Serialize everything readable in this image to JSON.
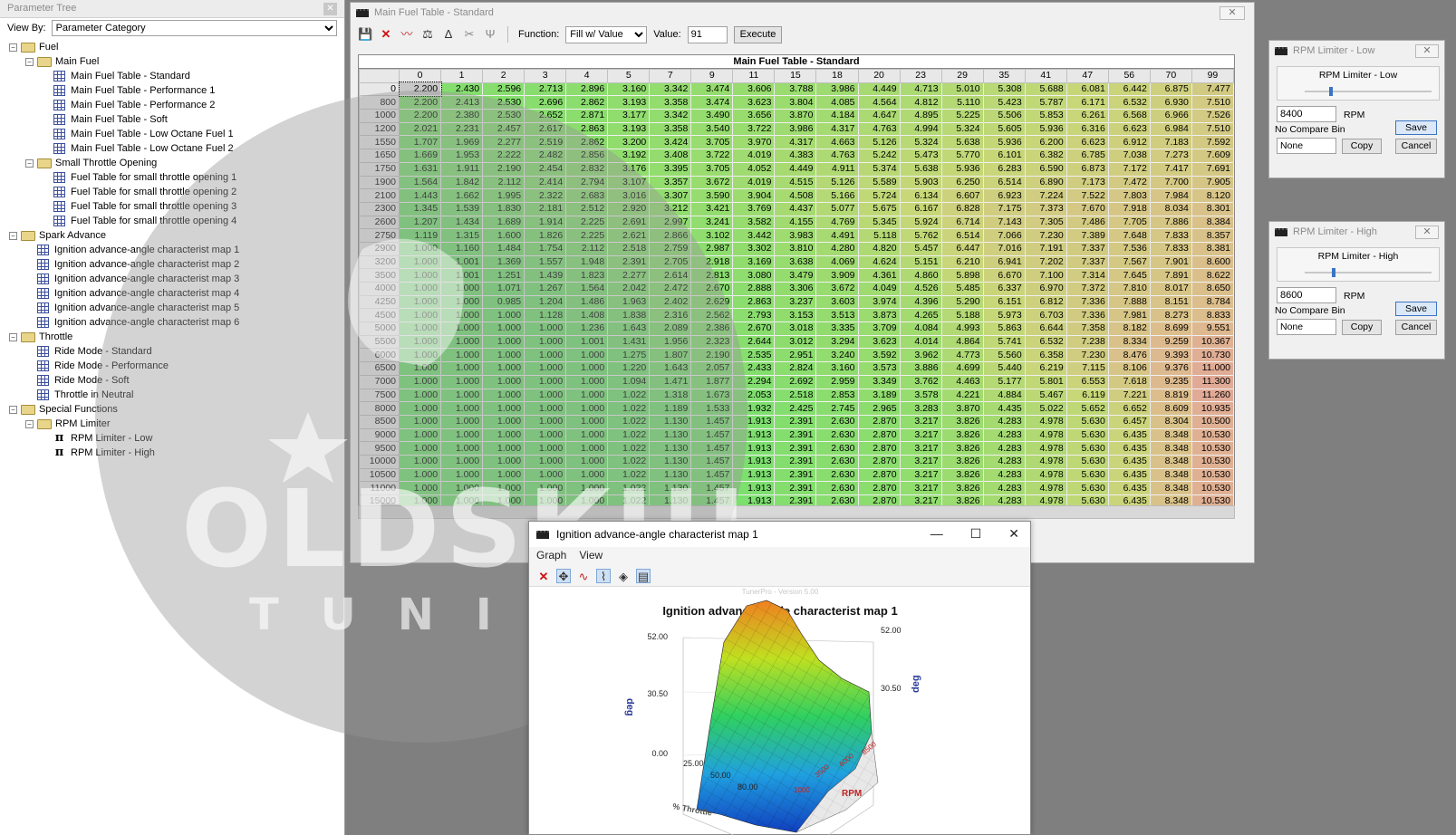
{
  "tree_panel": {
    "title": "Parameter Tree",
    "view_by_label": "View By:",
    "view_by_value": "Parameter Category",
    "nodes": [
      {
        "level": 0,
        "type": "folder",
        "label": "Fuel"
      },
      {
        "level": 1,
        "type": "folder",
        "label": "Main Fuel"
      },
      {
        "level": 2,
        "type": "table",
        "label": "Main Fuel Table - Standard"
      },
      {
        "level": 2,
        "type": "table",
        "label": "Main Fuel Table - Performance 1"
      },
      {
        "level": 2,
        "type": "table",
        "label": "Main Fuel Table - Performance 2"
      },
      {
        "level": 2,
        "type": "table",
        "label": "Main Fuel Table - Soft"
      },
      {
        "level": 2,
        "type": "table",
        "label": "Main Fuel Table - Low Octane Fuel 1"
      },
      {
        "level": 2,
        "type": "table",
        "label": "Main Fuel Table - Low Octane Fuel 2"
      },
      {
        "level": 1,
        "type": "folder",
        "label": "Small Throttle Opening"
      },
      {
        "level": 2,
        "type": "table",
        "label": "Fuel Table for small throttle opening 1"
      },
      {
        "level": 2,
        "type": "table",
        "label": "Fuel Table for small throttle opening 2"
      },
      {
        "level": 2,
        "type": "table",
        "label": "Fuel Table for small throttle opening 3"
      },
      {
        "level": 2,
        "type": "table",
        "label": "Fuel Table for small throttle opening 4"
      },
      {
        "level": 0,
        "type": "folder",
        "label": "Spark Advance"
      },
      {
        "level": 1,
        "type": "table",
        "label": "Ignition advance-angle characterist map 1"
      },
      {
        "level": 1,
        "type": "table",
        "label": "Ignition advance-angle characterist map 2"
      },
      {
        "level": 1,
        "type": "table",
        "label": "Ignition advance-angle characterist map 3"
      },
      {
        "level": 1,
        "type": "table",
        "label": "Ignition advance-angle characterist map 4"
      },
      {
        "level": 1,
        "type": "table",
        "label": "Ignition advance-angle characterist map 5"
      },
      {
        "level": 1,
        "type": "table",
        "label": "Ignition advance-angle characterist map 6"
      },
      {
        "level": 0,
        "type": "folder",
        "label": "Throttle"
      },
      {
        "level": 1,
        "type": "table",
        "label": "Ride Mode - Standard"
      },
      {
        "level": 1,
        "type": "table",
        "label": "Ride Mode - Performance"
      },
      {
        "level": 1,
        "type": "table",
        "label": "Ride Mode - Soft"
      },
      {
        "level": 1,
        "type": "table",
        "label": "Throttle in Neutral"
      },
      {
        "level": 0,
        "type": "folder",
        "label": "Special Functions"
      },
      {
        "level": 1,
        "type": "folder",
        "label": "RPM Limiter"
      },
      {
        "level": 2,
        "type": "scalar",
        "label": "RPM Limiter - Low"
      },
      {
        "level": 2,
        "type": "scalar",
        "label": "RPM Limiter - High"
      }
    ]
  },
  "main_window": {
    "title": "Main Fuel Table - Standard",
    "function_label": "Function:",
    "function_value": "Fill w/ Value",
    "value_label": "Value:",
    "value_value": "91",
    "execute_label": "Execute",
    "table_title": "Main Fuel Table - Standard",
    "col_headers": [
      "0",
      "1",
      "2",
      "3",
      "4",
      "5",
      "7",
      "9",
      "11",
      "15",
      "18",
      "20",
      "23",
      "29",
      "35",
      "41",
      "47",
      "56",
      "70",
      "99"
    ],
    "row_headers": [
      "0",
      "800",
      "1000",
      "1200",
      "1550",
      "1650",
      "1750",
      "1900",
      "2100",
      "2300",
      "2600",
      "2750",
      "2900",
      "3200",
      "3500",
      "4000",
      "4250",
      "4500",
      "5000",
      "5500",
      "6000",
      "6500",
      "7000",
      "7500",
      "8000",
      "8500",
      "9000",
      "9500",
      "10000",
      "10500",
      "11000",
      "15000"
    ],
    "rows": [
      [
        "2.200",
        "2.430",
        "2.596",
        "2.713",
        "2.896",
        "3.160",
        "3.342",
        "3.474",
        "3.606",
        "3.788",
        "3.986",
        "4.449",
        "4.713",
        "5.010",
        "5.308",
        "5.688",
        "6.081",
        "6.442",
        "6.875",
        "7.477"
      ],
      [
        "2.200",
        "2.413",
        "2.530",
        "2.696",
        "2.862",
        "3.193",
        "3.358",
        "3.474",
        "3.623",
        "3.804",
        "4.085",
        "4.564",
        "4.812",
        "5.110",
        "5.423",
        "5.787",
        "6.171",
        "6.532",
        "6.930",
        "7.510"
      ],
      [
        "2.200",
        "2.380",
        "2.530",
        "2.652",
        "2.871",
        "3.177",
        "3.342",
        "3.490",
        "3.656",
        "3.870",
        "4.184",
        "4.647",
        "4.895",
        "5.225",
        "5.506",
        "5.853",
        "6.261",
        "6.568",
        "6.966",
        "7.526"
      ],
      [
        "2.021",
        "2.231",
        "2.457",
        "2.617",
        "2.863",
        "3.193",
        "3.358",
        "3.540",
        "3.722",
        "3.986",
        "4.317",
        "4.763",
        "4.994",
        "5.324",
        "5.605",
        "5.936",
        "6.316",
        "6.623",
        "6.984",
        "7.510"
      ],
      [
        "1.707",
        "1.969",
        "2.277",
        "2.519",
        "2.862",
        "3.200",
        "3.424",
        "3.705",
        "3.970",
        "4.317",
        "4.663",
        "5.126",
        "5.324",
        "5.638",
        "5.936",
        "6.200",
        "6.623",
        "6.912",
        "7.183",
        "7.592"
      ],
      [
        "1.669",
        "1.953",
        "2.222",
        "2.482",
        "2.856",
        "3.192",
        "3.408",
        "3.722",
        "4.019",
        "4.383",
        "4.763",
        "5.242",
        "5.473",
        "5.770",
        "6.101",
        "6.382",
        "6.785",
        "7.038",
        "7.273",
        "7.609"
      ],
      [
        "1.631",
        "1.911",
        "2.190",
        "2.454",
        "2.832",
        "3.176",
        "3.395",
        "3.705",
        "4.052",
        "4.449",
        "4.911",
        "5.374",
        "5.638",
        "5.936",
        "6.283",
        "6.590",
        "6.873",
        "7.172",
        "7.417",
        "7.691"
      ],
      [
        "1.564",
        "1.842",
        "2.112",
        "2.414",
        "2.794",
        "3.107",
        "3.357",
        "3.672",
        "4.019",
        "4.515",
        "5.126",
        "5.589",
        "5.903",
        "6.250",
        "6.514",
        "6.890",
        "7.173",
        "7.472",
        "7.700",
        "7.905"
      ],
      [
        "1.443",
        "1.662",
        "1.995",
        "2.322",
        "2.683",
        "3.016",
        "3.307",
        "3.590",
        "3.904",
        "4.508",
        "5.166",
        "5.724",
        "6.134",
        "6.607",
        "6.923",
        "7.224",
        "7.522",
        "7.803",
        "7.984",
        "8.120"
      ],
      [
        "1.345",
        "1.539",
        "1.830",
        "2.181",
        "2.512",
        "2.920",
        "3.212",
        "3.421",
        "3.769",
        "4.437",
        "5.077",
        "5.675",
        "6.167",
        "6.828",
        "7.175",
        "7.373",
        "7.670",
        "7.918",
        "8.034",
        "8.301"
      ],
      [
        "1.207",
        "1.434",
        "1.689",
        "1.914",
        "2.225",
        "2.691",
        "2.997",
        "3.241",
        "3.582",
        "4.155",
        "4.769",
        "5.345",
        "5.924",
        "6.714",
        "7.143",
        "7.305",
        "7.486",
        "7.705",
        "7.886",
        "8.384"
      ],
      [
        "1.119",
        "1.315",
        "1.600",
        "1.826",
        "2.225",
        "2.621",
        "2.866",
        "3.102",
        "3.442",
        "3.983",
        "4.491",
        "5.118",
        "5.762",
        "6.514",
        "7.066",
        "7.230",
        "7.389",
        "7.648",
        "7.833",
        "8.357"
      ],
      [
        "1.000",
        "1.160",
        "1.484",
        "1.754",
        "2.112",
        "2.518",
        "2.759",
        "2.987",
        "3.302",
        "3.810",
        "4.280",
        "4.820",
        "5.457",
        "6.447",
        "7.016",
        "7.191",
        "7.337",
        "7.536",
        "7.833",
        "8.381"
      ],
      [
        "1.000",
        "1.001",
        "1.369",
        "1.557",
        "1.948",
        "2.391",
        "2.705",
        "2.918",
        "3.169",
        "3.638",
        "4.069",
        "4.624",
        "5.151",
        "6.210",
        "6.941",
        "7.202",
        "7.337",
        "7.567",
        "7.901",
        "8.600"
      ],
      [
        "1.000",
        "1.001",
        "1.251",
        "1.439",
        "1.823",
        "2.277",
        "2.614",
        "2.813",
        "3.080",
        "3.479",
        "3.909",
        "4.361",
        "4.860",
        "5.898",
        "6.670",
        "7.100",
        "7.314",
        "7.645",
        "7.891",
        "8.622"
      ],
      [
        "1.000",
        "1.000",
        "1.071",
        "1.267",
        "1.564",
        "2.042",
        "2.472",
        "2.670",
        "2.888",
        "3.306",
        "3.672",
        "4.049",
        "4.526",
        "5.485",
        "6.337",
        "6.970",
        "7.372",
        "7.810",
        "8.017",
        "8.650"
      ],
      [
        "1.000",
        "1.000",
        "0.985",
        "1.204",
        "1.486",
        "1.963",
        "2.402",
        "2.629",
        "2.863",
        "3.237",
        "3.603",
        "3.974",
        "4.396",
        "5.290",
        "6.151",
        "6.812",
        "7.336",
        "7.888",
        "8.151",
        "8.784"
      ],
      [
        "1.000",
        "1.000",
        "1.000",
        "1.128",
        "1.408",
        "1.838",
        "2.316",
        "2.562",
        "2.793",
        "3.153",
        "3.513",
        "3.873",
        "4.265",
        "5.188",
        "5.973",
        "6.703",
        "7.336",
        "7.981",
        "8.273",
        "8.833"
      ],
      [
        "1.000",
        "1.000",
        "1.000",
        "1.000",
        "1.236",
        "1.643",
        "2.089",
        "2.386",
        "2.670",
        "3.018",
        "3.335",
        "3.709",
        "4.084",
        "4.993",
        "5.863",
        "6.644",
        "7.358",
        "8.182",
        "8.699",
        "9.551"
      ],
      [
        "1.000",
        "1.000",
        "1.000",
        "1.000",
        "1.001",
        "1.431",
        "1.956",
        "2.323",
        "2.644",
        "3.012",
        "3.294",
        "3.623",
        "4.014",
        "4.864",
        "5.741",
        "6.532",
        "7.238",
        "8.334",
        "9.259",
        "10.367"
      ],
      [
        "1.000",
        "1.000",
        "1.000",
        "1.000",
        "1.000",
        "1.275",
        "1.807",
        "2.190",
        "2.535",
        "2.951",
        "3.240",
        "3.592",
        "3.962",
        "4.773",
        "5.560",
        "6.358",
        "7.230",
        "8.476",
        "9.393",
        "10.730"
      ],
      [
        "1.000",
        "1.000",
        "1.000",
        "1.000",
        "1.000",
        "1.220",
        "1.643",
        "2.057",
        "2.433",
        "2.824",
        "3.160",
        "3.573",
        "3.886",
        "4.699",
        "5.440",
        "6.219",
        "7.115",
        "8.106",
        "9.376",
        "11.000"
      ],
      [
        "1.000",
        "1.000",
        "1.000",
        "1.000",
        "1.000",
        "1.094",
        "1.471",
        "1.877",
        "2.294",
        "2.692",
        "2.959",
        "3.349",
        "3.762",
        "4.463",
        "5.177",
        "5.801",
        "6.553",
        "7.618",
        "9.235",
        "11.300"
      ],
      [
        "1.000",
        "1.000",
        "1.000",
        "1.000",
        "1.000",
        "1.022",
        "1.318",
        "1.673",
        "2.053",
        "2.518",
        "2.853",
        "3.189",
        "3.578",
        "4.221",
        "4.884",
        "5.467",
        "6.119",
        "7.221",
        "8.819",
        "11.260"
      ],
      [
        "1.000",
        "1.000",
        "1.000",
        "1.000",
        "1.000",
        "1.022",
        "1.189",
        "1.533",
        "1.932",
        "2.425",
        "2.745",
        "2.965",
        "3.283",
        "3.870",
        "4.435",
        "5.022",
        "5.652",
        "6.652",
        "8.609",
        "10.935"
      ],
      [
        "1.000",
        "1.000",
        "1.000",
        "1.000",
        "1.000",
        "1.022",
        "1.130",
        "1.457",
        "1.913",
        "2.391",
        "2.630",
        "2.870",
        "3.217",
        "3.826",
        "4.283",
        "4.978",
        "5.630",
        "6.457",
        "8.304",
        "10.500"
      ],
      [
        "1.000",
        "1.000",
        "1.000",
        "1.000",
        "1.000",
        "1.022",
        "1.130",
        "1.457",
        "1.913",
        "2.391",
        "2.630",
        "2.870",
        "3.217",
        "3.826",
        "4.283",
        "4.978",
        "5.630",
        "6.435",
        "8.348",
        "10.530"
      ],
      [
        "1.000",
        "1.000",
        "1.000",
        "1.000",
        "1.000",
        "1.022",
        "1.130",
        "1.457",
        "1.913",
        "2.391",
        "2.630",
        "2.870",
        "3.217",
        "3.826",
        "4.283",
        "4.978",
        "5.630",
        "6.435",
        "8.348",
        "10.530"
      ],
      [
        "1.000",
        "1.000",
        "1.000",
        "1.000",
        "1.000",
        "1.022",
        "1.130",
        "1.457",
        "1.913",
        "2.391",
        "2.630",
        "2.870",
        "3.217",
        "3.826",
        "4.283",
        "4.978",
        "5.630",
        "6.435",
        "8.348",
        "10.530"
      ],
      [
        "1.000",
        "1.000",
        "1.000",
        "1.000",
        "1.000",
        "1.022",
        "1.130",
        "1.457",
        "1.913",
        "2.391",
        "2.630",
        "2.870",
        "3.217",
        "3.826",
        "4.283",
        "4.978",
        "5.630",
        "6.435",
        "8.348",
        "10.530"
      ],
      [
        "1.000",
        "1.000",
        "1.000",
        "1.000",
        "1.000",
        "1.022",
        "1.130",
        "1.457",
        "1.913",
        "2.391",
        "2.630",
        "2.870",
        "3.217",
        "3.826",
        "4.283",
        "4.978",
        "5.630",
        "6.435",
        "8.348",
        "10.530"
      ],
      [
        "1.000",
        "1.000",
        "1.000",
        "1.000",
        "1.000",
        "1.022",
        "1.130",
        "1.457",
        "1.913",
        "2.391",
        "2.630",
        "2.870",
        "3.217",
        "3.826",
        "4.283",
        "4.978",
        "5.630",
        "6.435",
        "8.348",
        "10.530"
      ]
    ],
    "colors": {
      "low": "#6ee06e",
      "mid": "#b8d870",
      "high": "#d8b890",
      "selected": "#c8c8c8"
    }
  },
  "rpm_low": {
    "title": "RPM Limiter - Low",
    "label": "RPM Limiter - Low",
    "value": "8400",
    "unit": "RPM",
    "compare_label": "No Compare Bin",
    "compare_value": "None",
    "save": "Save",
    "copy": "Copy",
    "cancel": "Cancel",
    "slider_fraction": 0.2
  },
  "rpm_high": {
    "title": "RPM Limiter - High",
    "label": "RPM Limiter - High",
    "value": "8600",
    "unit": "RPM",
    "compare_label": "No Compare Bin",
    "compare_value": "None",
    "save": "Save",
    "copy": "Copy",
    "cancel": "Cancel",
    "slider_fraction": 0.22
  },
  "graph_window": {
    "title": "Ignition advance-angle characterist map 1",
    "menu": [
      "Graph",
      "View"
    ],
    "watermark": "TunerPro - Version 5.00",
    "chart_title": "Ignition advance-angle characterist map 1",
    "z_ticks_left": [
      "52.00",
      "30.50",
      "0.00"
    ],
    "z_ticks_right": [
      "52.00",
      "30.50"
    ],
    "z_label": "deg",
    "throttle_ticks": [
      "25.00",
      "50.00",
      "80.00"
    ],
    "throttle_label": "% Throttle",
    "rpm_ticks": [
      "1000",
      "3500",
      "6000",
      "8500"
    ],
    "rpm_label": "RPM"
  },
  "watermark": {
    "line1": "OLDSKULL",
    "line2": "TUNING"
  }
}
